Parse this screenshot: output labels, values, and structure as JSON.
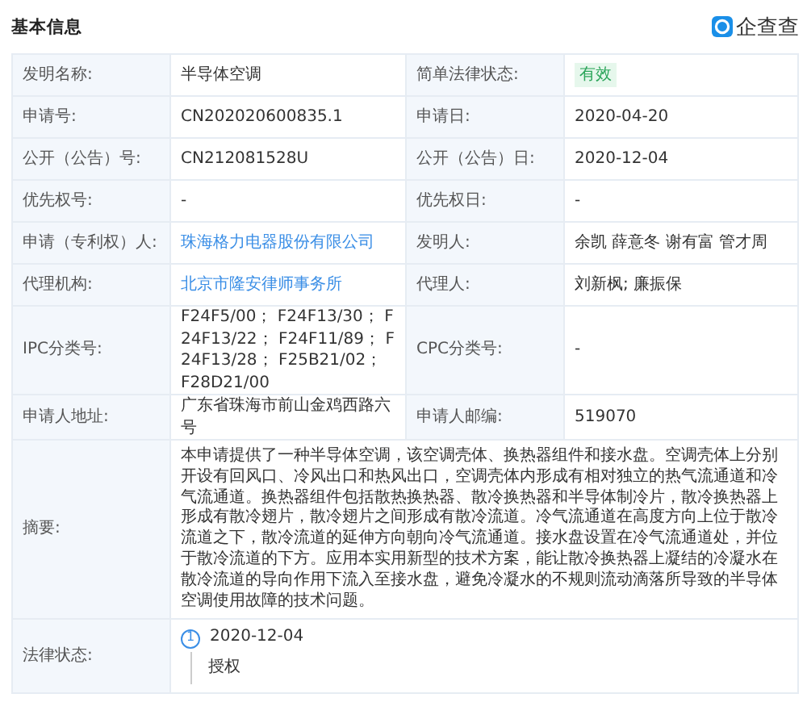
{
  "section_title": "基本信息",
  "logo": {
    "text": "企查查"
  },
  "rows": [
    {
      "kind": "pair",
      "cells": [
        {
          "kind": "label",
          "text": "发明名称:"
        },
        {
          "kind": "text",
          "text": "半导体空调"
        },
        {
          "kind": "label",
          "text": "简单法律状态:"
        },
        {
          "kind": "badge",
          "text": "有效"
        }
      ]
    },
    {
      "kind": "pair",
      "cells": [
        {
          "kind": "label",
          "text": "申请号:"
        },
        {
          "kind": "text",
          "text": "CN202020600835.1"
        },
        {
          "kind": "label",
          "text": "申请日:"
        },
        {
          "kind": "text",
          "text": "2020-04-20"
        }
      ]
    },
    {
      "kind": "pair",
      "cells": [
        {
          "kind": "label",
          "text": "公开（公告）号:"
        },
        {
          "kind": "text",
          "text": "CN212081528U"
        },
        {
          "kind": "label",
          "text": "公开（公告）日:"
        },
        {
          "kind": "text",
          "text": "2020-12-04"
        }
      ]
    },
    {
      "kind": "pair",
      "cells": [
        {
          "kind": "label",
          "text": "优先权号:"
        },
        {
          "kind": "text",
          "text": "-"
        },
        {
          "kind": "label",
          "text": "优先权日:"
        },
        {
          "kind": "text",
          "text": "-"
        }
      ]
    },
    {
      "kind": "pair",
      "cells": [
        {
          "kind": "label",
          "text": "申请（专利权）人:"
        },
        {
          "kind": "link",
          "text": "珠海格力电器股份有限公司"
        },
        {
          "kind": "label",
          "text": "发明人:"
        },
        {
          "kind": "text",
          "text": "余凯 薛意冬 谢有富 管才周"
        }
      ]
    },
    {
      "kind": "pair",
      "cells": [
        {
          "kind": "label",
          "text": "代理机构:"
        },
        {
          "kind": "link",
          "text": "北京市隆安律师事务所"
        },
        {
          "kind": "label",
          "text": "代理人:"
        },
        {
          "kind": "text",
          "text": "刘新枫; 廉振保"
        }
      ]
    },
    {
      "kind": "pair",
      "cells": [
        {
          "kind": "label",
          "text": "IPC分类号:"
        },
        {
          "kind": "text",
          "text": "F24F5/00； F24F13/30； F24F13/22； F24F11/89； F24F13/28； F25B21/02； F28D21/00"
        },
        {
          "kind": "label",
          "text": "CPC分类号:"
        },
        {
          "kind": "text",
          "text": "-"
        }
      ]
    },
    {
      "kind": "pair",
      "cells": [
        {
          "kind": "label",
          "text": "申请人地址:"
        },
        {
          "kind": "text",
          "text": "广东省珠海市前山金鸡西路六号"
        },
        {
          "kind": "label",
          "text": "申请人邮编:"
        },
        {
          "kind": "text",
          "text": "519070"
        }
      ]
    },
    {
      "kind": "wide",
      "label": "摘要:",
      "text": "本申请提供了一种半导体空调，该空调壳体、换热器组件和接水盘。空调壳体上分别开设有回风口、冷风出口和热风出口，空调壳体内形成有相对独立的热气流通道和冷气流通道。换热器组件包括散热换热器、散冷换热器和半导体制冷片，散冷换热器上形成有散冷翅片，散冷翅片之间形成有散冷流道。冷气流通道在高度方向上位于散冷流道之下，散冷流道的延伸方向朝向冷气流通道。接水盘设置在冷气流通道处，并位于散冷流道的下方。应用本实用新型的技术方案，能让散冷换热器上凝结的冷凝水在散冷流道的导向作用下流入至接水盘，避免冷凝水的不规则流动滴落所导致的半导体空调使用故障的技术问题。"
    },
    {
      "kind": "timeline",
      "label": "法律状态:",
      "events": [
        {
          "index": "1",
          "date": "2020-12-04",
          "status": "授权"
        }
      ]
    }
  ]
}
